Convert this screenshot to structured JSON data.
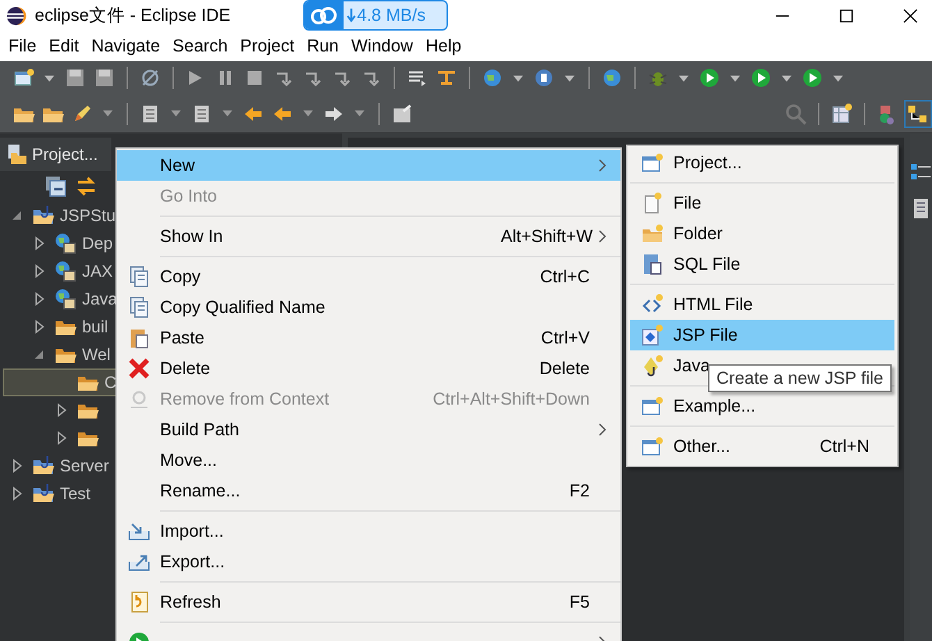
{
  "window": {
    "title": "eclipse文件 - Eclipse IDE"
  },
  "network_badge": {
    "speed": "4.8 MB/s"
  },
  "menu_bar": [
    "File",
    "Edit",
    "Navigate",
    "Search",
    "Project",
    "Run",
    "Window",
    "Help"
  ],
  "project_explorer": {
    "tab": "Project...",
    "tree": [
      {
        "label": "JSPStu",
        "kind": "project",
        "expanded": true,
        "selected": false,
        "children": [
          {
            "label": "Dep",
            "kind": "library",
            "expanded": false,
            "selected": false
          },
          {
            "label": "JAX",
            "kind": "library",
            "expanded": false,
            "selected": false
          },
          {
            "label": "Java",
            "kind": "library",
            "expanded": false,
            "selected": false
          },
          {
            "label": "buil",
            "kind": "folder",
            "expanded": false,
            "selected": false
          },
          {
            "label": "Wel",
            "kind": "folder",
            "expanded": true,
            "selected": false,
            "children": [
              {
                "label": "C",
                "kind": "folder",
                "selected": true
              },
              {
                "kind": "folder",
                "expanded": false,
                "selected": false
              },
              {
                "kind": "folder",
                "expanded": false,
                "selected": false
              }
            ]
          }
        ]
      },
      {
        "label": "Server",
        "kind": "project",
        "expanded": false,
        "selected": false
      },
      {
        "label": "Test",
        "kind": "project",
        "expanded": false,
        "selected": false
      }
    ]
  },
  "context_menu": {
    "groups": [
      [
        {
          "label": "New",
          "submenu": true,
          "selected": true,
          "disabled": false
        },
        {
          "label": "Go Into",
          "selected": false,
          "disabled": true
        }
      ],
      [
        {
          "label": "Show In",
          "shortcut": "Alt+Shift+W",
          "submenu": true,
          "selected": false,
          "disabled": false
        }
      ],
      [
        {
          "label": "Copy",
          "shortcut": "Ctrl+C",
          "selected": false,
          "disabled": false
        },
        {
          "label": "Copy Qualified Name",
          "selected": false,
          "disabled": false
        },
        {
          "label": "Paste",
          "shortcut": "Ctrl+V",
          "selected": false,
          "disabled": false
        },
        {
          "label": "Delete",
          "shortcut": "Delete",
          "selected": false,
          "disabled": false
        },
        {
          "label": "Remove from Context",
          "shortcut": "Ctrl+Alt+Shift+Down",
          "selected": false,
          "disabled": true
        },
        {
          "label": "Build Path",
          "submenu": true,
          "selected": false,
          "disabled": false
        },
        {
          "label": "Move...",
          "selected": false,
          "disabled": false
        },
        {
          "label": "Rename...",
          "shortcut": "F2",
          "selected": false,
          "disabled": false
        }
      ],
      [
        {
          "label": "Import...",
          "selected": false,
          "disabled": false
        },
        {
          "label": "Export...",
          "selected": false,
          "disabled": false
        }
      ],
      [
        {
          "label": "Refresh",
          "shortcut": "F5",
          "selected": false,
          "disabled": false
        }
      ],
      [
        {
          "submenu": true,
          "selected": false
        }
      ]
    ]
  },
  "new_submenu": {
    "groups": [
      [
        {
          "label": "Project...",
          "selected": false
        }
      ],
      [
        {
          "label": "File",
          "selected": false
        },
        {
          "label": "Folder",
          "selected": false
        },
        {
          "label": "SQL File",
          "selected": false
        }
      ],
      [
        {
          "label": "HTML File",
          "selected": false
        },
        {
          "label": "JSP File",
          "selected": true
        },
        {
          "label": "Java",
          "selected": false
        }
      ],
      [
        {
          "label": "Example...",
          "selected": false
        }
      ],
      [
        {
          "label": "Other...",
          "shortcut": "Ctrl+N",
          "selected": false
        }
      ]
    ]
  },
  "tooltip": {
    "text": "Create a new JSP file"
  }
}
